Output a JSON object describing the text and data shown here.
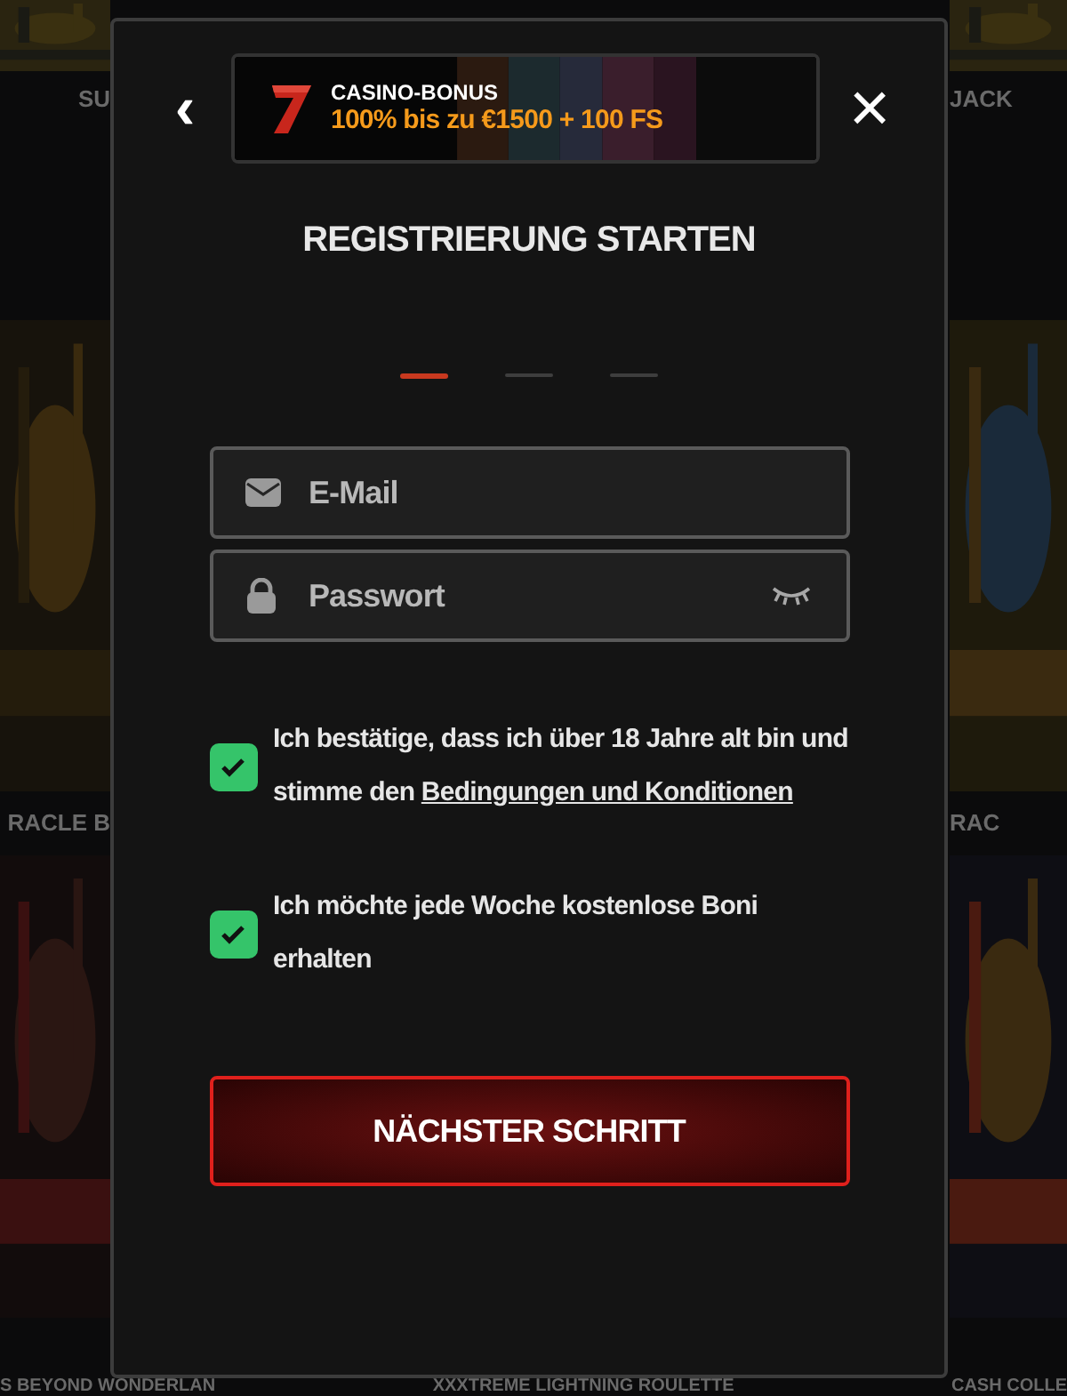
{
  "background": {
    "left_captions": [
      "SU",
      "RACLE B"
    ],
    "right_captions": [
      "JACK",
      "RAC"
    ],
    "bottom_captions": [
      "S BEYOND WONDERLAN",
      "XXXTREME LIGHTNING ROULETTE",
      "CASH COLLE"
    ]
  },
  "modal": {
    "back": "‹",
    "close": "×",
    "bonus": {
      "label": "CASINO-BONUS",
      "offer": "100% bis zu €1500 + 100 FS"
    },
    "title": "REGISTRIERUNG STARTEN",
    "steps": [
      {
        "selected": true
      },
      {
        "selected": false
      },
      {
        "selected": false
      }
    ],
    "fields": [
      {
        "kind": "email",
        "placeholder": "E-Mail"
      },
      {
        "kind": "password",
        "placeholder": "Passwort"
      }
    ],
    "consents": [
      {
        "checked": true,
        "text": "Ich bestätige, dass ich über 18 Jahre alt bin und stimme den",
        "link": "Bedingungen und Konditionen"
      },
      {
        "checked": true,
        "text": "Ich möchte jede Woche kostenlose Boni erhalten"
      }
    ],
    "submit": "NÄCHSTER SCHRITT"
  }
}
